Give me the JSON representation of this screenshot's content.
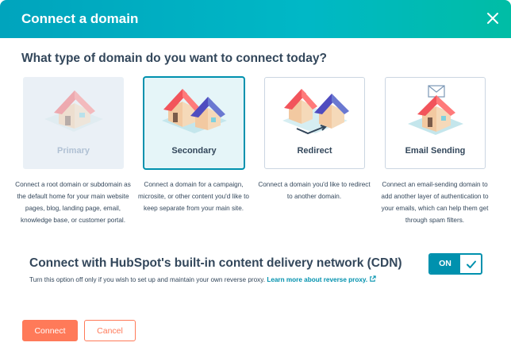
{
  "dialog": {
    "title": "Connect a domain",
    "close_icon": "close-icon"
  },
  "question": "What type of domain do you want to connect today?",
  "options": [
    {
      "label": "Primary",
      "state": "disabled",
      "icon": "house-icon",
      "description": "Connect a root domain or subdomain as the default home for your main website pages, blog, landing page, email, knowledge base, or customer portal."
    },
    {
      "label": "Secondary",
      "state": "selected",
      "icon": "two-houses-icon",
      "description": "Connect a domain for a campaign, microsite, or other content you'd like to keep separate from your main site."
    },
    {
      "label": "Redirect",
      "state": "default",
      "icon": "redirect-houses-icon",
      "description": "Connect a domain you'd like to redirect to another domain."
    },
    {
      "label": "Email Sending",
      "state": "default",
      "icon": "email-house-icon",
      "description": "Connect an email-sending domain to add another layer of authentication to your emails, which can help them get through spam filters."
    }
  ],
  "cdn": {
    "title": "Connect with HubSpot's built-in content delivery network (CDN)",
    "description": "Turn this option off only if you wish to set up and maintain your own reverse proxy.",
    "link_text": "Learn more about reverse proxy.",
    "toggle_label": "ON"
  },
  "footer": {
    "primary_label": "Connect",
    "secondary_label": "Cancel"
  },
  "colors": {
    "header_start": "#00a4bd",
    "header_end": "#00bda5",
    "accent": "#0091ae",
    "button": "#ff7a59",
    "text": "#33475b"
  }
}
